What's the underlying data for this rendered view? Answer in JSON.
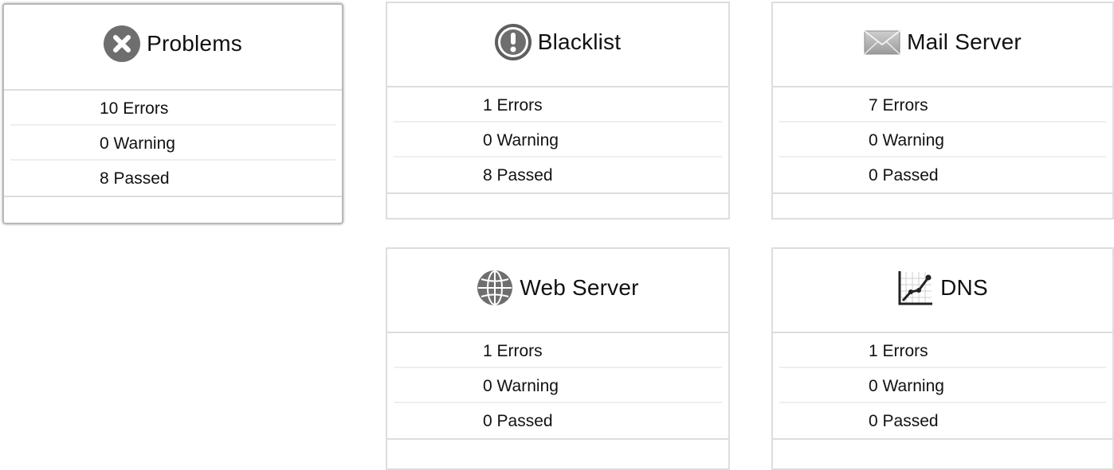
{
  "cards": [
    {
      "id": "problems",
      "title": "Problems",
      "icon": "error-x-circle-icon",
      "stats": [
        "10 Errors",
        "0 Warning",
        "8 Passed"
      ]
    },
    {
      "id": "blacklist",
      "title": "Blacklist",
      "icon": "exclamation-circle-icon",
      "stats": [
        "1 Errors",
        "0 Warning",
        "8 Passed"
      ]
    },
    {
      "id": "mail",
      "title": "Mail Server",
      "icon": "envelope-icon",
      "stats": [
        "7 Errors",
        "0 Warning",
        "0 Passed"
      ]
    },
    {
      "id": "web",
      "title": "Web Server",
      "icon": "globe-icon",
      "stats": [
        "1 Errors",
        "0 Warning",
        "0 Passed"
      ]
    },
    {
      "id": "dns",
      "title": "DNS",
      "icon": "line-chart-icon",
      "stats": [
        "1 Errors",
        "0 Warning",
        "0 Passed"
      ]
    }
  ],
  "colors": {
    "border": "#dddddd",
    "divider": "#eeeeee",
    "icon": "#666666",
    "text": "#111111"
  }
}
